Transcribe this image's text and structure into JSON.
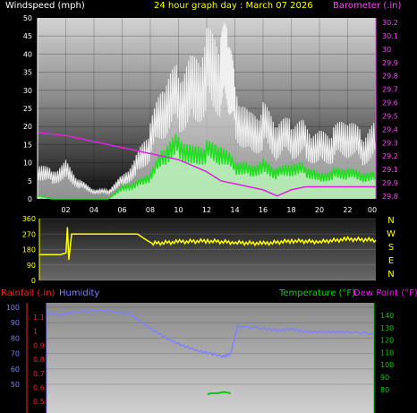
{
  "header": {
    "windspeed_label": "Windspeed (mph)",
    "graph_title": "24 hour graph day : March 07 2026",
    "barometer_label": "Barometer (.in)"
  },
  "colors": {
    "background": "#000000",
    "wind_gust": "#f0f0f0",
    "wind_avg": "#22dd22",
    "wind_avg_fill": "#b8f0b8",
    "barometer": "#e020e0",
    "direction": "#ffff00",
    "humidity": "#8080ff",
    "temperature": "#00cc00",
    "rainfall": "#ff2020",
    "dew_point": "#ff00ff",
    "axis_text_left": "#ffffff",
    "axis_text_baro": "#ff44ff"
  },
  "compass": [
    "N",
    "W",
    "S",
    "E",
    "N"
  ],
  "bottom_header": {
    "rainfall_label": "Rainfall (.in)",
    "humidity_label": "Humidity",
    "temperature_label": "Temperature (°F)",
    "dewpoint_label": "Dew Point (°F)"
  },
  "chart_data": [
    {
      "type": "line",
      "title": "24 hour graph day : March 07 2026",
      "x_tick_labels": [
        "02",
        "04",
        "06",
        "08",
        "10",
        "12",
        "14",
        "16",
        "18",
        "20",
        "22",
        "00"
      ],
      "y_left_label": "Windspeed (mph)",
      "y_left_ticks": [
        0,
        5,
        10,
        15,
        20,
        25,
        30,
        35,
        40,
        45,
        50
      ],
      "ylim_left": [
        0,
        50
      ],
      "y_right_label": "Barometer (.in)",
      "y_right_ticks": [
        "29.8",
        "29.9",
        "29.1",
        "29.2",
        "29.3",
        "29.4",
        "29.5",
        "29.6",
        "29.7",
        "29.8",
        "29.9",
        "30",
        "30.1",
        "30.2"
      ],
      "grid": true,
      "series": [
        {
          "name": "Barometer",
          "x": [
            0,
            2,
            4,
            6,
            8,
            10,
            11,
            12,
            13,
            14,
            15,
            16,
            17,
            18,
            19,
            20,
            21,
            22,
            23,
            24
          ],
          "values": [
            29.92,
            29.91,
            29.89,
            29.87,
            29.85,
            29.83,
            29.81,
            29.79,
            29.76,
            29.75,
            29.74,
            29.73,
            29.71,
            29.73,
            29.74,
            29.74,
            29.74,
            29.74,
            29.74,
            29.74
          ]
        },
        {
          "name": "Wind gust",
          "x": [
            0,
            1,
            2,
            3,
            4,
            5,
            6,
            7,
            8,
            9,
            10,
            11,
            12,
            13,
            13.5,
            14,
            15,
            16,
            17,
            18,
            19,
            20,
            21,
            22,
            23,
            24
          ],
          "values": [
            8,
            6,
            8,
            4,
            2,
            2,
            5,
            9,
            16,
            25,
            28,
            30,
            35,
            35,
            37,
            25,
            18,
            20,
            16,
            17,
            16,
            14,
            15,
            17,
            14,
            16
          ]
        },
        {
          "name": "Wind average",
          "x": [
            0,
            1,
            2,
            3,
            4,
            5,
            6,
            7,
            8,
            9,
            10,
            11,
            12,
            13,
            14,
            15,
            16,
            17,
            18,
            19,
            20,
            21,
            22,
            23,
            24
          ],
          "values": [
            1,
            0,
            0,
            0,
            0,
            0,
            3,
            4,
            6,
            12,
            15,
            12,
            13,
            12,
            9,
            8,
            9,
            7,
            8,
            8,
            6,
            7,
            7,
            6,
            6
          ]
        }
      ]
    },
    {
      "type": "line",
      "y_ticks": [
        0,
        90,
        180,
        270,
        360
      ],
      "ylim": [
        0,
        360
      ],
      "series": [
        {
          "name": "Wind direction",
          "x": [
            0,
            1.5,
            1.9,
            2.0,
            2.1,
            2.3,
            3,
            5,
            7,
            8,
            10,
            12,
            14,
            16,
            18,
            20,
            22,
            24
          ],
          "values": [
            150,
            150,
            160,
            310,
            120,
            270,
            270,
            270,
            270,
            215,
            225,
            230,
            220,
            215,
            230,
            225,
            240,
            235
          ]
        }
      ]
    },
    {
      "type": "line",
      "rainfall_ticks": [
        "1.1",
        "1",
        "0.9",
        "0.8",
        "0.7",
        "0.6",
        "0.5"
      ],
      "humidity_ticks": [
        100,
        90,
        80,
        70,
        60,
        50
      ],
      "temperature_ticks": [
        140,
        130,
        120,
        110,
        100,
        90,
        80
      ],
      "series": [
        {
          "name": "Humidity",
          "x": [
            0,
            1,
            2,
            4,
            6,
            7,
            8,
            9,
            10,
            11,
            12,
            13,
            13.5,
            14,
            16,
            17,
            18,
            19,
            20,
            21,
            22,
            24
          ],
          "values": [
            96,
            95,
            97,
            98,
            96,
            90,
            84,
            79,
            75,
            72,
            70,
            68,
            70,
            88,
            86,
            85,
            86,
            84,
            84,
            84,
            84,
            83
          ]
        },
        {
          "name": "Temperature",
          "x": [
            11.8,
            12,
            12.5,
            13,
            13.5
          ],
          "values": [
            76,
            77,
            77,
            78,
            77
          ]
        }
      ]
    }
  ]
}
